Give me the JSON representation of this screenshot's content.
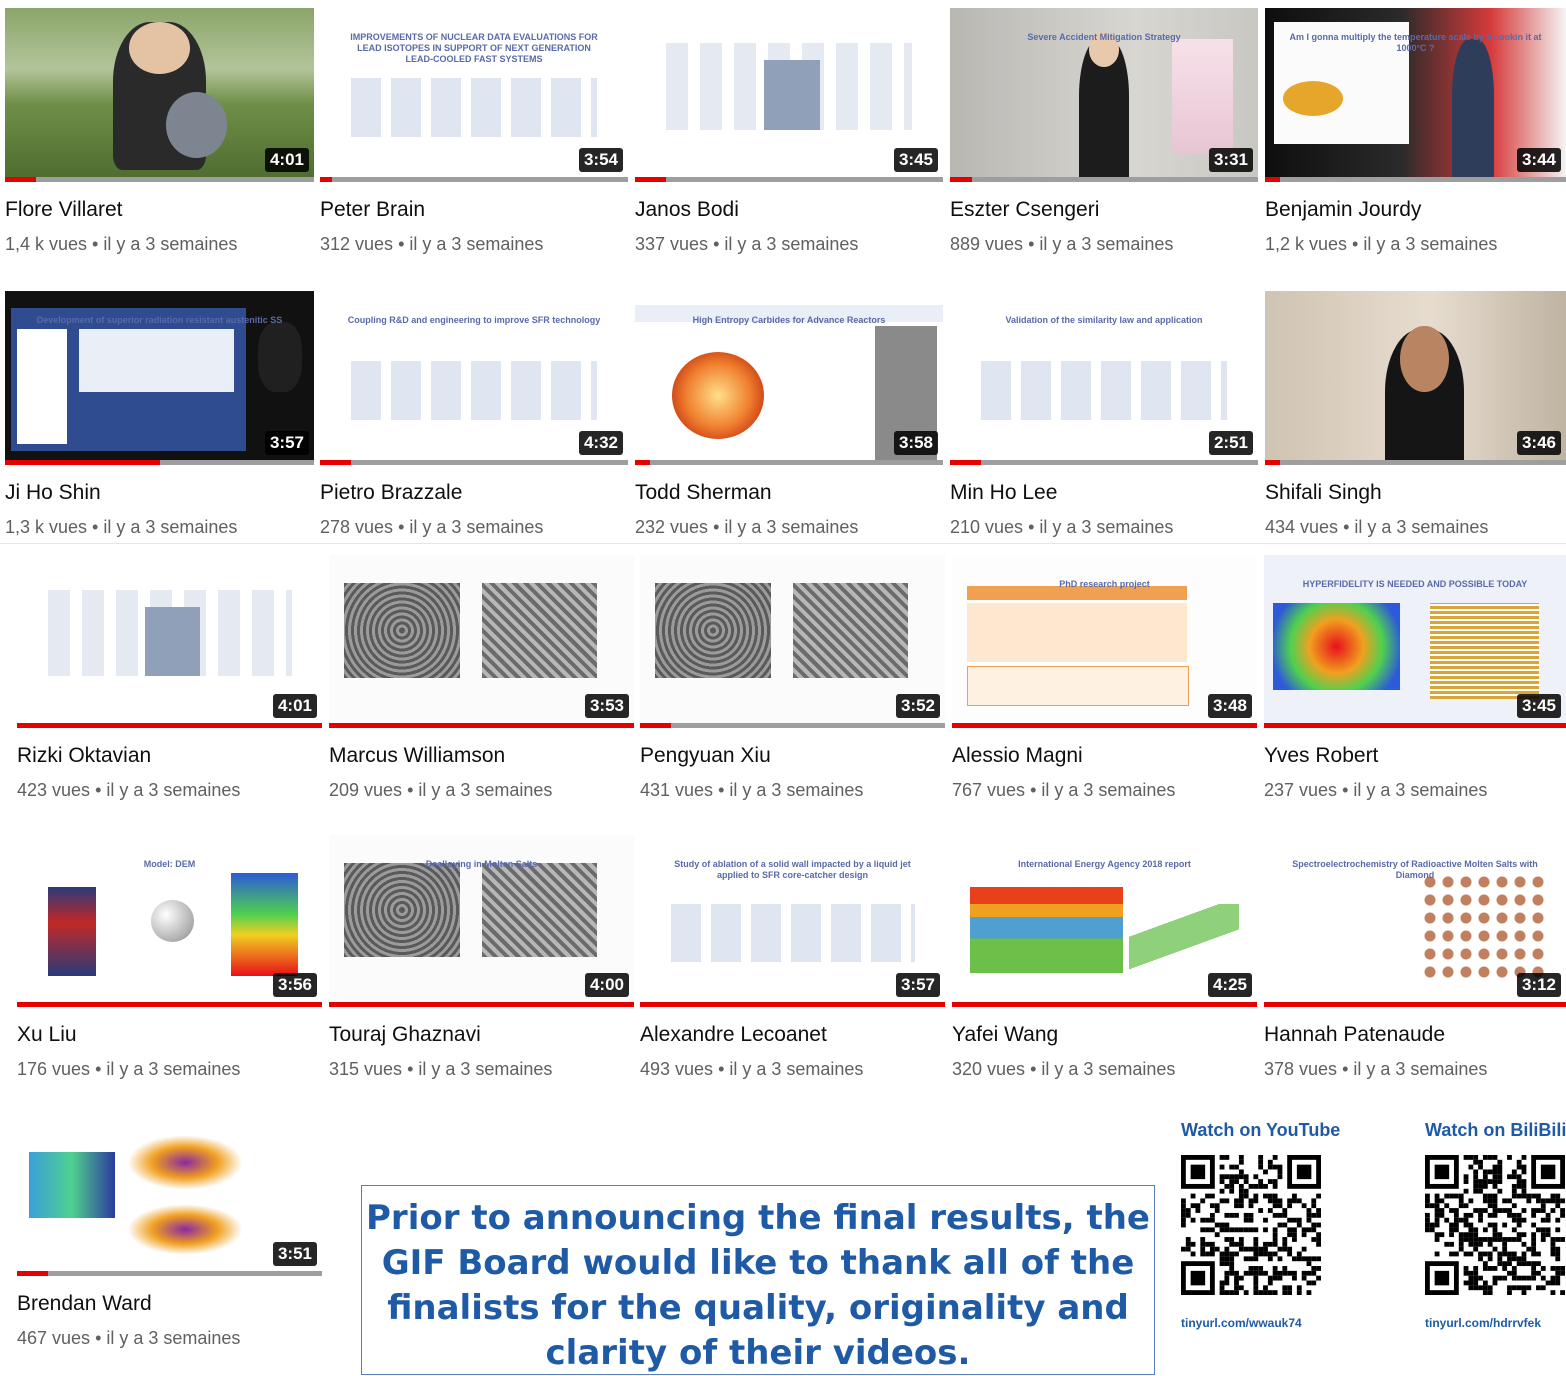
{
  "videos": [
    {
      "name": "Flore Villaret",
      "views": "1,4 k vues",
      "age": "il y a 3 semaines",
      "duration": "4:01",
      "progress": 0.1,
      "theme": "photo-garden",
      "slide": ""
    },
    {
      "name": "Peter Brain",
      "views": "312 vues",
      "age": "il y a 3 semaines",
      "duration": "3:54",
      "progress": 0.04,
      "theme": "slide-white",
      "slide": "IMPROVEMENTS OF NUCLEAR DATA EVALUATIONS FOR LEAD ISOTOPES IN SUPPORT OF NEXT GENERATION LEAD-COOLED FAST SYSTEMS"
    },
    {
      "name": "Janos Bodi",
      "views": "337 vues",
      "age": "il y a 3 semaines",
      "duration": "3:45",
      "progress": 0.1,
      "theme": "slide-diagram",
      "slide": ""
    },
    {
      "name": "Eszter Csengeri",
      "views": "889 vues",
      "age": "il y a 3 semaines",
      "duration": "3:31",
      "progress": 0.07,
      "theme": "presenter",
      "slide": "Severe Accident Mitigation Strategy"
    },
    {
      "name": "Benjamin Jourdy",
      "views": "1,2 k vues",
      "age": "il y a 3 semaines",
      "duration": "3:44",
      "progress": 0.05,
      "theme": "presenter-dark",
      "slide": "Am I gonna multiply the temperature scale by 5 cookin it at 1000°C ?"
    },
    {
      "name": "Ji Ho Shin",
      "views": "1,3 k vues",
      "age": "il y a 3 semaines",
      "duration": "3:57",
      "progress": 0.5,
      "theme": "slide-dark",
      "slide": "Development of superior radiation resistant austenitic SS"
    },
    {
      "name": "Pietro Brazzale",
      "views": "278 vues",
      "age": "il y a 3 semaines",
      "duration": "4:32",
      "progress": 0.1,
      "theme": "slide-white",
      "slide": "Coupling R&D and engineering to improve SFR technology"
    },
    {
      "name": "Todd Sherman",
      "views": "232 vues",
      "age": "il y a 3 semaines",
      "duration": "3:58",
      "progress": 0.05,
      "theme": "slide-burst",
      "slide": "High Entropy Carbides for Advance Reactors"
    },
    {
      "name": "Min Ho Lee",
      "views": "210 vues",
      "age": "il y a 3 semaines",
      "duration": "2:51",
      "progress": 0.1,
      "theme": "slide-white",
      "slide": "Validation of the similarity law and application"
    },
    {
      "name": "Shifali Singh",
      "views": "434 vues",
      "age": "il y a 3 semaines",
      "duration": "3:46",
      "progress": 0.05,
      "theme": "presenter-home",
      "slide": ""
    },
    {
      "name": "Rizki Oktavian",
      "views": "423 vues",
      "age": "il y a 3 semaines",
      "duration": "4:01",
      "progress": 1.0,
      "theme": "slide-diagram",
      "slide": ""
    },
    {
      "name": "Marcus Williamson",
      "views": "209 vues",
      "age": "il y a 3 semaines",
      "duration": "3:53",
      "progress": 1.0,
      "theme": "slide-micro",
      "slide": ""
    },
    {
      "name": "Pengyuan Xiu",
      "views": "431 vues",
      "age": "il y a 3 semaines",
      "duration": "3:52",
      "progress": 0.1,
      "theme": "slide-micro",
      "slide": ""
    },
    {
      "name": "Alessio Magni",
      "views": "767 vues",
      "age": "il y a 3 semaines",
      "duration": "3:48",
      "progress": 1.0,
      "theme": "slide-orange",
      "slide": "PhD research project"
    },
    {
      "name": "Yves Robert",
      "views": "237 vues",
      "age": "il y a 3 semaines",
      "duration": "3:45",
      "progress": 1.0,
      "theme": "slide-heat",
      "slide": "HYPERFIDELITY IS NEEDED AND POSSIBLE TODAY"
    },
    {
      "name": "Xu Liu",
      "views": "176 vues",
      "age": "il y a 3 semaines",
      "duration": "3:56",
      "progress": 1.0,
      "theme": "slide-dem",
      "slide": "Model: DEM"
    },
    {
      "name": "Touraj Ghaznavi",
      "views": "315 vues",
      "age": "il y a 3 semaines",
      "duration": "4:00",
      "progress": 1.0,
      "theme": "slide-micro",
      "slide": "Dealloying in Molten Salts"
    },
    {
      "name": "Alexandre Lecoanet",
      "views": "493 vues",
      "age": "il y a 3 semaines",
      "duration": "3:57",
      "progress": 1.0,
      "theme": "slide-white",
      "slide": "Study of ablation of a solid wall impacted by a liquid jet applied to SFR core-catcher design"
    },
    {
      "name": "Yafei Wang",
      "views": "320 vues",
      "age": "il y a 3 semaines",
      "duration": "4:25",
      "progress": 1.0,
      "theme": "slide-energy",
      "slide": "International Energy Agency 2018 report"
    },
    {
      "name": "Hannah Patenaude",
      "views": "378 vues",
      "age": "il y a 3 semaines",
      "duration": "3:12",
      "progress": 1.0,
      "theme": "slide-dots",
      "slide": "Spectroelectrochemistry of Radioactive Molten Salts with Diamond"
    },
    {
      "name": "Brendan Ward",
      "views": "467 vues",
      "age": "il y a 3 semaines",
      "duration": "3:51",
      "progress": 0.1,
      "theme": "slide-scatter",
      "slide": ""
    }
  ],
  "announcement": {
    "text": "Prior to announcing the final results, the GIF Board would like to thank all of the finalists for the quality, originality and clarity of their videos."
  },
  "qr": [
    {
      "title": "Watch on YouTube",
      "url": "tinyurl.com/wwauk74"
    },
    {
      "title": "Watch on BiliBili",
      "url": "tinyurl.com/hdrrvfek"
    }
  ],
  "colors": {
    "accent": "#1f5aa6",
    "progress": "#e60000",
    "meta": "#606060"
  }
}
